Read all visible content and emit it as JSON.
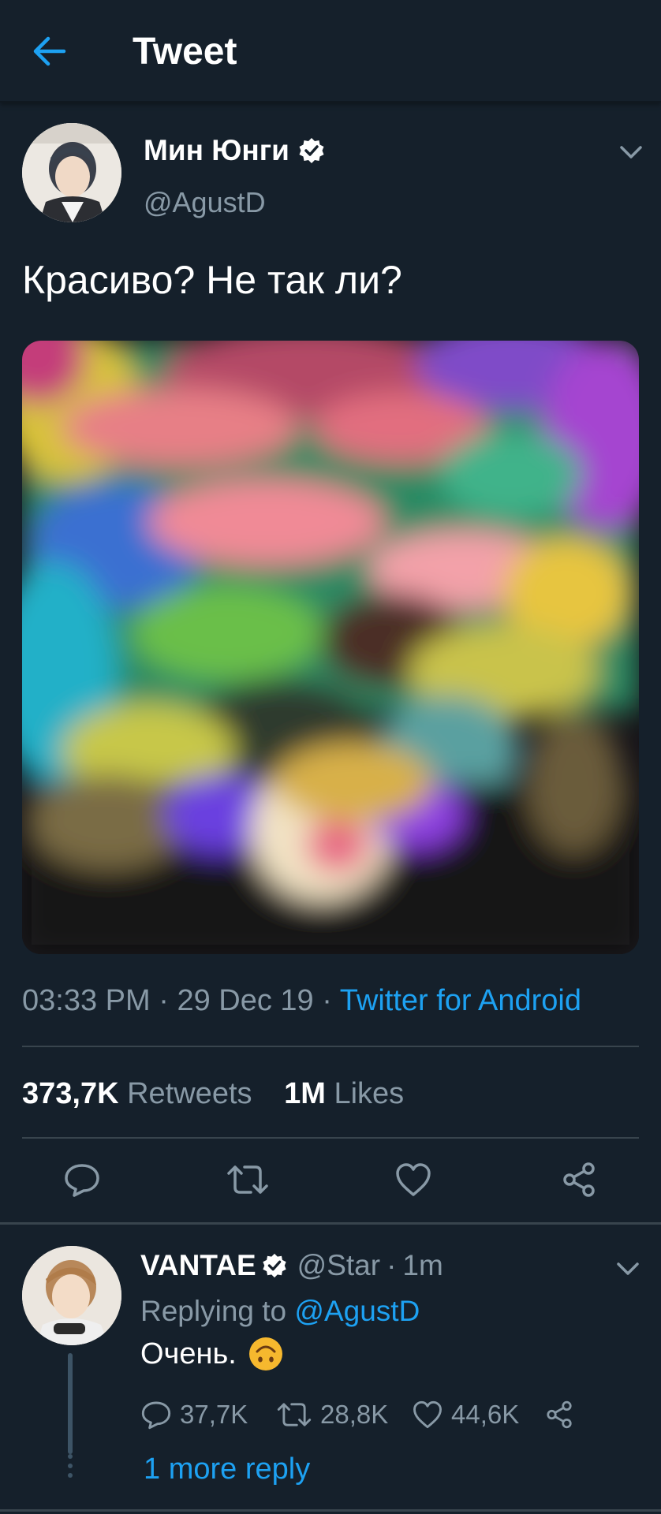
{
  "header": {
    "title": "Tweet",
    "back_icon": "arrow-left-icon"
  },
  "colors": {
    "background": "#15202b",
    "accent": "#1da1f2",
    "secondary_text": "#8899a6",
    "divider": "#38444d"
  },
  "tweet": {
    "author_name": "Мин Юнги",
    "author_handle": "@AgustD",
    "verified": true,
    "text": "Красиво? Не так ли?",
    "time": "03:33 PM",
    "date": "29 Dec 19",
    "separator": " · ",
    "source": "Twitter for Android",
    "retweets_count": "373,7K",
    "retweets_label": "Retweets",
    "likes_count": "1M",
    "likes_label": "Likes",
    "actions": [
      "reply-icon",
      "retweet-icon",
      "like-icon",
      "share-icon"
    ]
  },
  "reply": {
    "author_name": "VANTAE",
    "author_handle": "@Star",
    "time_ago": "1m",
    "verified": true,
    "replying_prefix": "Replying to",
    "replying_to": "@AgustD",
    "text": "Очень.",
    "emoji": "upside-down-face-emoji",
    "reply_count": "37,7K",
    "retweet_count": "28,8K",
    "like_count": "44,6K",
    "more_replies": "1 more reply"
  }
}
